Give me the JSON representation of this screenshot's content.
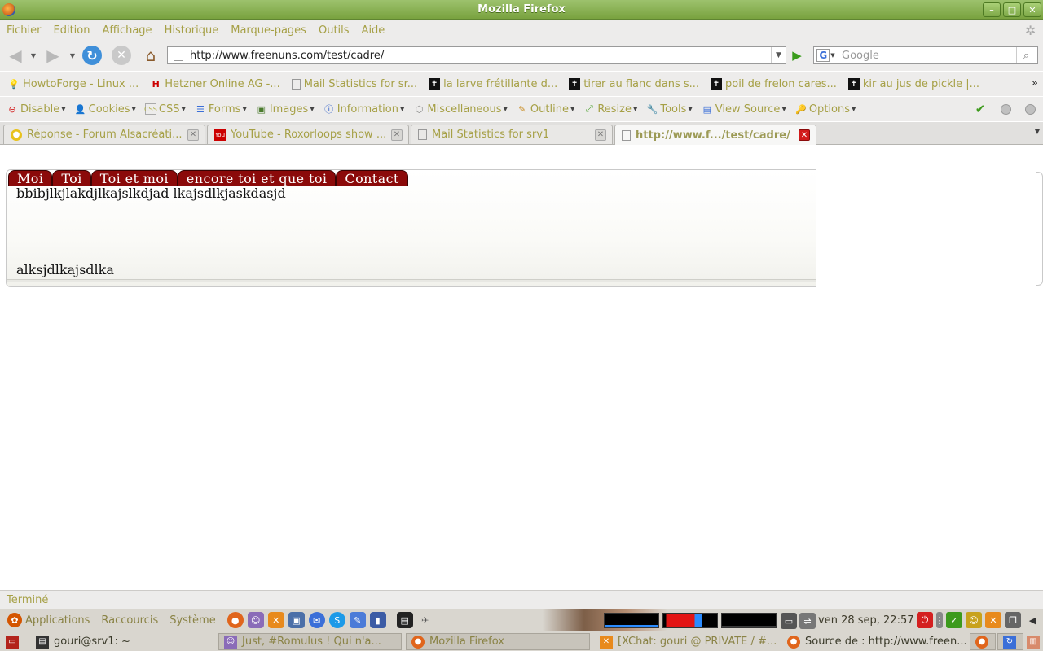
{
  "window": {
    "title": "Mozilla Firefox"
  },
  "menubar": {
    "items": [
      "Fichier",
      "Edition",
      "Affichage",
      "Historique",
      "Marque-pages",
      "Outils",
      "Aide"
    ]
  },
  "navbar": {
    "url": "http://www.freenuns.com/test/cadre/",
    "search_placeholder": "Google"
  },
  "bookmarks": {
    "items": [
      {
        "label": "HowtoForge - Linux ...",
        "icon": "bulb-icon"
      },
      {
        "label": "Hetzner Online AG -...",
        "icon": "hetzner-icon"
      },
      {
        "label": "Mail Statistics for sr...",
        "icon": "page-icon"
      },
      {
        "label": "la larve frétillante d...",
        "icon": "freenuns-icon"
      },
      {
        "label": "tirer au flanc dans s...",
        "icon": "freenuns-icon"
      },
      {
        "label": "poil de frelon cares...",
        "icon": "freenuns-icon"
      },
      {
        "label": "kir au jus de pickle |...",
        "icon": "freenuns-icon"
      }
    ]
  },
  "devbar": {
    "items": [
      "Disable",
      "Cookies",
      "CSS",
      "Forms",
      "Images",
      "Information",
      "Miscellaneous",
      "Outline",
      "Resize",
      "Tools",
      "View Source",
      "Options"
    ]
  },
  "tabs": [
    {
      "label": "Réponse - Forum Alsacréati...",
      "active": false
    },
    {
      "label": "YouTube - Roxorloops show ...",
      "active": false
    },
    {
      "label": "Mail Statistics for srv1",
      "active": false
    },
    {
      "label": "http://www.f.../test/cadre/",
      "active": true
    }
  ],
  "page": {
    "menu": [
      "Moi",
      "Toi",
      "Toi et moi",
      "encore toi et que toi",
      "Contact"
    ],
    "text1": "bbibjlkjlakdjlkajslkdjad lkajsdlkjaskdasjd",
    "text2": "alksjdlkajsdlka"
  },
  "status": {
    "text": "Terminé"
  },
  "panel": {
    "menus": [
      "Applications",
      "Raccourcis",
      "Système"
    ],
    "clock": "ven 28 sep, 22:57"
  },
  "taskbar": [
    {
      "label": "gouri@srv1: ~",
      "icon": "terminal-icon"
    },
    {
      "label": "Just, #Romulus ! Qui n'a...",
      "icon": "chat-icon"
    },
    {
      "label": "Mozilla Firefox",
      "icon": "firefox-icon"
    },
    {
      "label": "[XChat: gouri @ PRIVATE / #...",
      "icon": "xchat-icon"
    },
    {
      "label": "Source de : http://www.freen...",
      "icon": "firefox-icon"
    }
  ]
}
